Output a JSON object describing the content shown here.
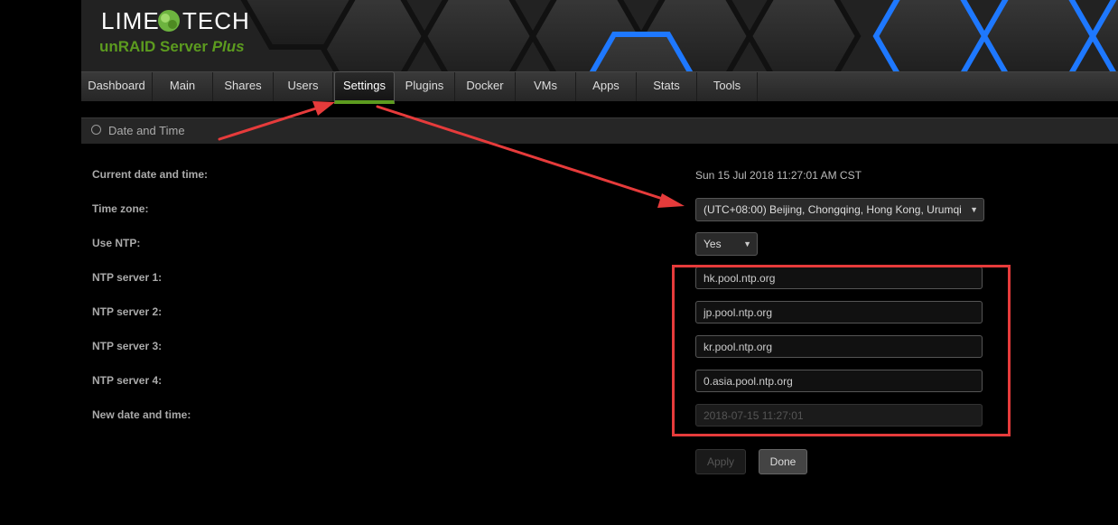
{
  "header": {
    "logo_left": "LIME",
    "logo_right": "TECH",
    "product": "unRAID Server",
    "edition": "Plus"
  },
  "nav": {
    "tabs": [
      "Dashboard",
      "Main",
      "Shares",
      "Users",
      "Settings",
      "Plugins",
      "Docker",
      "VMs",
      "Apps",
      "Stats",
      "Tools"
    ],
    "active": "Settings"
  },
  "section": {
    "title": "Date and Time"
  },
  "form": {
    "current_label": "Current date and time:",
    "current_value": "Sun 15 Jul 2018 11:27:01 AM CST",
    "timezone_label": "Time zone:",
    "timezone_value": "(UTC+08:00) Beijing, Chongqing, Hong Kong, Urumqi",
    "ntp_label": "Use NTP:",
    "ntp_value": "Yes",
    "ntp1_label": "NTP server 1:",
    "ntp1_value": "hk.pool.ntp.org",
    "ntp2_label": "NTP server 2:",
    "ntp2_value": "jp.pool.ntp.org",
    "ntp3_label": "NTP server 3:",
    "ntp3_value": "kr.pool.ntp.org",
    "ntp4_label": "NTP server 4:",
    "ntp4_value": "0.asia.pool.ntp.org",
    "new_label": "New date and time:",
    "new_value": "2018-07-15 11:27:01"
  },
  "buttons": {
    "apply": "Apply",
    "done": "Done"
  },
  "colors": {
    "accent": "#5c9b1f",
    "annotation": "#e63b3b",
    "hex_glow": "#1e78ff"
  }
}
